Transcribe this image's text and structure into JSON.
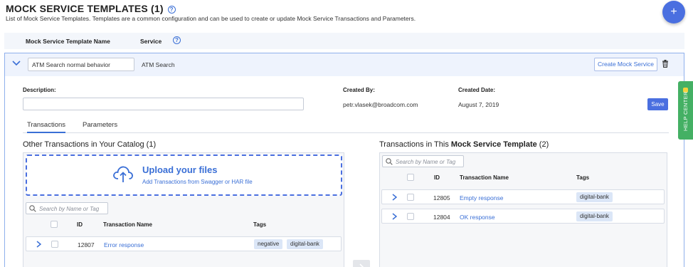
{
  "header": {
    "title": "MOCK SERVICE TEMPLATES (1)",
    "help_glyph": "?",
    "subtitle": "List of Mock Service Templates. Templates are a common configuration and can be used to create or update Mock Service Transactions and Parameters.",
    "add_glyph": "+"
  },
  "columns": {
    "template_name": "Mock Service Template Name",
    "service": "Service",
    "help_glyph": "?"
  },
  "template": {
    "name_value": "ATM Search normal behavior",
    "service": "ATM Search",
    "create_label": "Create Mock Service",
    "description_label": "Description:",
    "description_value": "",
    "created_by_label": "Created By:",
    "created_by": "petr.vlasek@broadcom.com",
    "created_date_label": "Created Date:",
    "created_date": "August 7, 2019",
    "save_label": "Save"
  },
  "tabs": [
    {
      "label": "Transactions",
      "active": true
    },
    {
      "label": "Parameters",
      "active": false
    }
  ],
  "catalog": {
    "title": "Other Transactions in Your Catalog (1)",
    "upload_title": "Upload your files",
    "upload_sub": "Add Transactions from Swagger or HAR file",
    "search_placeholder": "Search by Name or Tag",
    "headers": {
      "id": "ID",
      "name": "Transaction Name",
      "tags": "Tags"
    },
    "rows": [
      {
        "id": "12807",
        "name": "Error response",
        "tags": [
          "negative",
          "digital-bank"
        ]
      }
    ]
  },
  "template_transactions": {
    "title_prefix": "Transactions in This ",
    "title_bold": "Mock Service Template",
    "title_suffix": " (2)",
    "search_placeholder": "Search by Name or Tag",
    "headers": {
      "id": "ID",
      "name": "Transaction Name",
      "tags": "Tags"
    },
    "rows": [
      {
        "id": "12805",
        "name": "Empty response",
        "tags": [
          "digital-bank"
        ]
      },
      {
        "id": "12804",
        "name": "OK response",
        "tags": [
          "digital-bank"
        ]
      }
    ]
  },
  "help_center": {
    "label": "HELP CENTER"
  },
  "colors": {
    "accent": "#4a6fe0",
    "link": "#3a6fd6",
    "help": "#44b064",
    "tag_bg": "#dbe6f7"
  },
  "icons": [
    "help-icon",
    "plus-icon",
    "chevron-down-icon",
    "trash-icon",
    "cloud-upload-icon",
    "search-icon",
    "chevron-right-icon",
    "arrow-right-icon"
  ]
}
